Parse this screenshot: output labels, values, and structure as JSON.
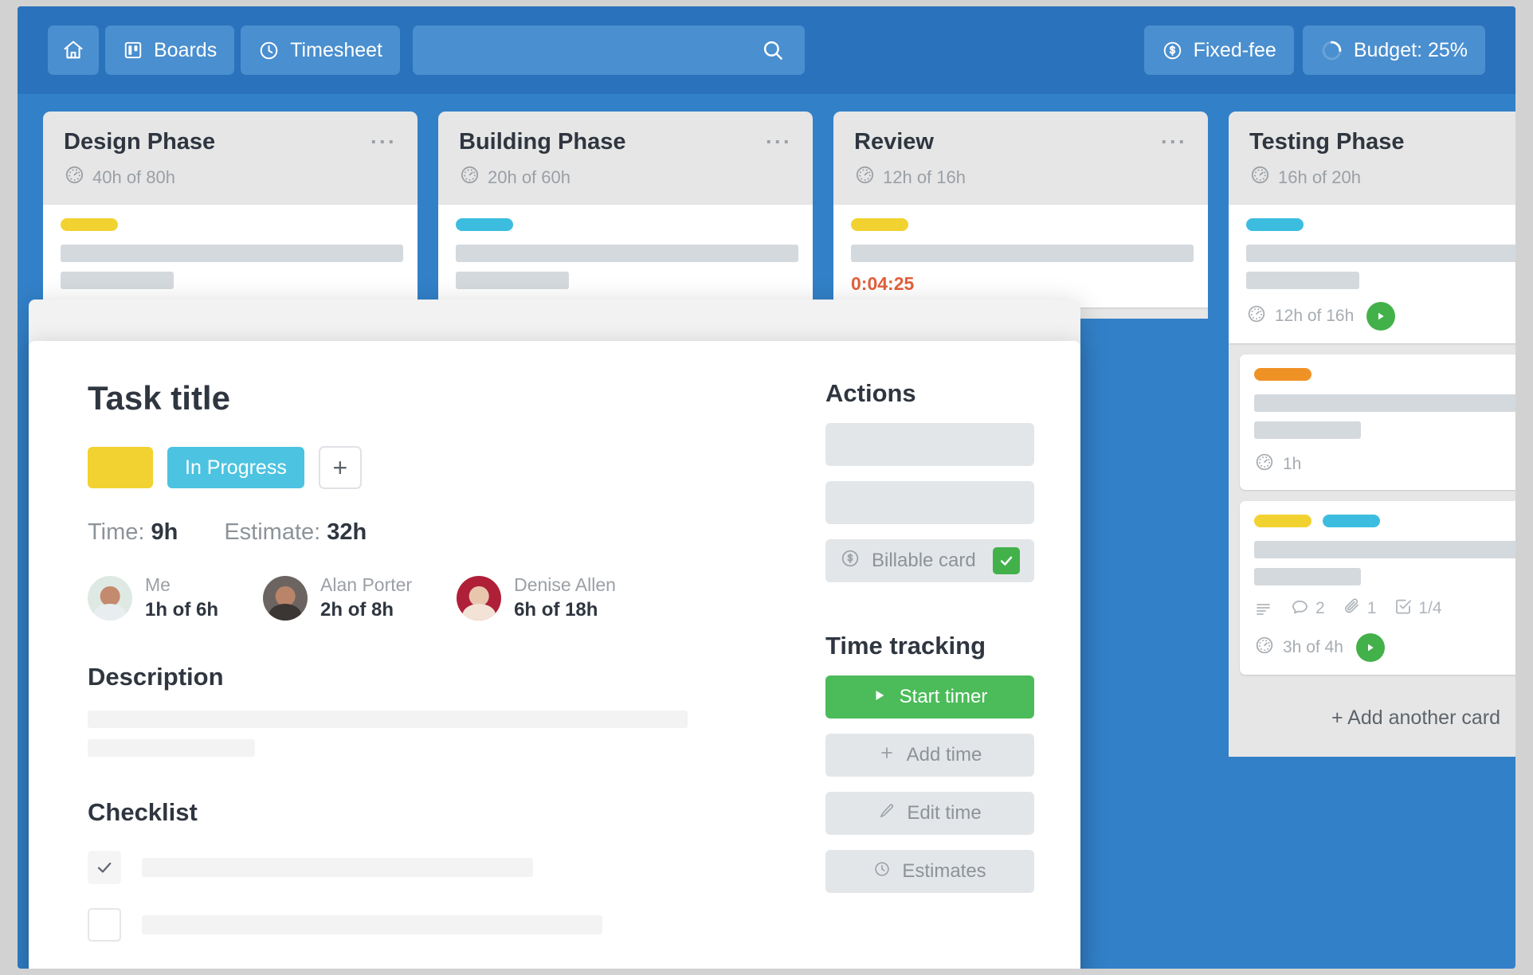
{
  "topbar": {
    "home_icon": "home-icon",
    "boards_label": "Boards",
    "boards_icon": "board-icon",
    "timesheet_label": "Timesheet",
    "timesheet_icon": "clock-icon",
    "search_placeholder": "",
    "search_value": "",
    "search_icon": "search-icon",
    "fixed_fee_label": "Fixed-fee",
    "fixed_fee_icon": "dollar-circle-icon",
    "budget_label": "Budget: 25%",
    "budget_icon": "budget-donut-icon",
    "bar_color": "#2a72bb",
    "btn_color": "#4a8fcf"
  },
  "board": {
    "background": "#3280c8",
    "columns": [
      {
        "title": "Design Phase",
        "time": "40h of 80h",
        "menu": "···",
        "cards": [
          {
            "labels": [
              "#f2d231"
            ],
            "lines": [
              "w-full",
              "w-short"
            ],
            "foot": null,
            "badges": []
          }
        ],
        "add_card": ""
      },
      {
        "title": "Building Phase",
        "time": "20h of 60h",
        "menu": "···",
        "cards": [
          {
            "labels": [
              "#3cbde0"
            ],
            "lines": [
              "w-full",
              "w-short"
            ],
            "foot": null,
            "badges": []
          }
        ],
        "add_card": ""
      },
      {
        "title": "Review",
        "time": "12h of 16h",
        "menu": "···",
        "cards": [
          {
            "labels": [
              "#f2d231"
            ],
            "lines": [
              "w-full"
            ],
            "foot": null,
            "badges": []
          }
        ],
        "timer": "0:04:25",
        "add_card": ""
      },
      {
        "title": "Testing Phase",
        "time": "16h of 20h",
        "menu": "",
        "cards": [
          {
            "labels": [
              "#3cbde0"
            ],
            "lines": [
              "w-full",
              "w-short"
            ],
            "foot": {
              "time": "12h of 16h",
              "play": true
            },
            "badges": []
          },
          {
            "labels": [
              "#ef9226"
            ],
            "lines": [
              "w-full",
              "w-short"
            ],
            "foot": {
              "time": "1h",
              "play": false
            },
            "badges": []
          },
          {
            "labels": [
              "#f2d231",
              "#3cbde0"
            ],
            "lines": [
              "w-full",
              "w-short"
            ],
            "foot": {
              "time": "3h of 4h",
              "play": true
            },
            "badges": [
              {
                "icon": "description-icon",
                "value": ""
              },
              {
                "icon": "comment-icon",
                "value": "2"
              },
              {
                "icon": "attachment-icon",
                "value": "1"
              },
              {
                "icon": "checklist-icon",
                "value": "1/4"
              }
            ]
          }
        ],
        "add_card": "+ Add another card"
      }
    ]
  },
  "modal": {
    "close_icon": "close-icon",
    "title": "Task title",
    "tag_color": "#f2d231",
    "status_label": "In Progress",
    "status_color": "#4cc3e0",
    "add_tag_label": "+",
    "time_label": "Time:",
    "time_value": "9h",
    "estimate_label": "Estimate:",
    "estimate_value": "32h",
    "people": [
      {
        "name": "Me",
        "time": "1h of 6h",
        "avatar_bg": "#dfe9e4",
        "head": "#c48a6e",
        "body": "#e8eef0"
      },
      {
        "name": "Alan Porter",
        "time": "2h of 8h",
        "avatar_bg": "#6b6461",
        "head": "#b9846a",
        "body": "#3b3533"
      },
      {
        "name": "Denise Allen",
        "time": "6h of 18h",
        "avatar_bg": "#b01f38",
        "head": "#e8c6ae",
        "body": "#f2e3d6"
      }
    ],
    "description_heading": "Description",
    "checklist_heading": "Checklist",
    "checklist": [
      {
        "checked": true,
        "check_icon": "check-icon"
      },
      {
        "checked": false,
        "check_icon": ""
      }
    ],
    "actions_heading": "Actions",
    "billable_label": "Billable card",
    "billable_icon": "dollar-circle-icon",
    "billable_checked": true,
    "billable_check_color": "#42b14a",
    "time_tracking_heading": "Time tracking",
    "start_timer_label": "Start timer",
    "start_timer_icon": "play-icon",
    "start_timer_color": "#4cbb5a",
    "add_time_label": "Add time",
    "add_time_icon": "plus-icon",
    "edit_time_label": "Edit time",
    "edit_time_icon": "pencil-icon",
    "estimates_label": "Estimates",
    "estimates_icon": "clock-icon"
  }
}
